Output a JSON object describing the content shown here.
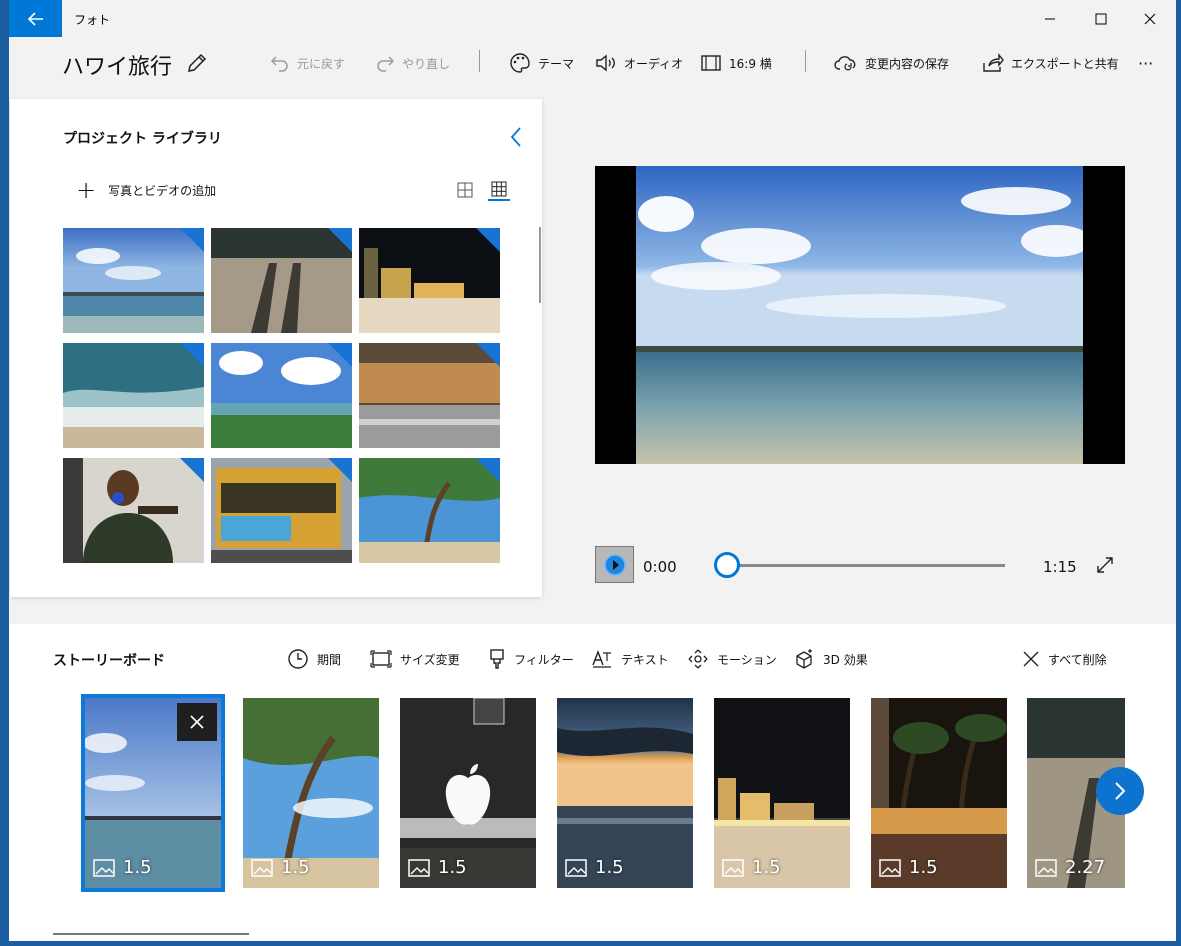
{
  "window": {
    "app_title": "フォト",
    "back_label": "←",
    "minimize_label": "—",
    "maximize_label": "☐",
    "close_label": "✕"
  },
  "command_bar": {
    "project_title": "ハワイ旅行",
    "undo": "元に戻す",
    "redo": "やり直し",
    "theme": "テーマ",
    "audio": "オーディオ",
    "aspect": "16:9 横",
    "save": "変更内容の保存",
    "export": "エクスポートと共有",
    "more": "···"
  },
  "library": {
    "title": "プロジェクト ライブラリ",
    "add_media": "写真とビデオの追加",
    "add_symbol": "+",
    "thumbnails": [
      {
        "desc": "beach-sky"
      },
      {
        "desc": "shadow-sand"
      },
      {
        "desc": "night-city"
      },
      {
        "desc": "waves"
      },
      {
        "desc": "shore-clouds"
      },
      {
        "desc": "market"
      },
      {
        "desc": "shooting-range"
      },
      {
        "desc": "trolley"
      },
      {
        "desc": "palm-beach"
      }
    ]
  },
  "player": {
    "current_time": "0:00",
    "total_time": "1:15",
    "progress": 0.0
  },
  "storyboard": {
    "title": "ストーリーボード",
    "tools": {
      "duration": "期間",
      "resize": "サイズ変更",
      "filter": "フィルター",
      "text": "テキスト",
      "motion": "モーション",
      "effects3d": "3D 効果",
      "delete_all": "すべて削除"
    },
    "clips": [
      {
        "duration": "1.5",
        "selected": true
      },
      {
        "duration": "1.5",
        "selected": false
      },
      {
        "duration": "1.5",
        "selected": false
      },
      {
        "duration": "1.5",
        "selected": false
      },
      {
        "duration": "1.5",
        "selected": false
      },
      {
        "duration": "1.5",
        "selected": false
      },
      {
        "duration": "2.27",
        "selected": false
      }
    ]
  },
  "colors": {
    "accent": "#0078d7",
    "panel": "#ffffff",
    "background": "#f2f2f2"
  }
}
